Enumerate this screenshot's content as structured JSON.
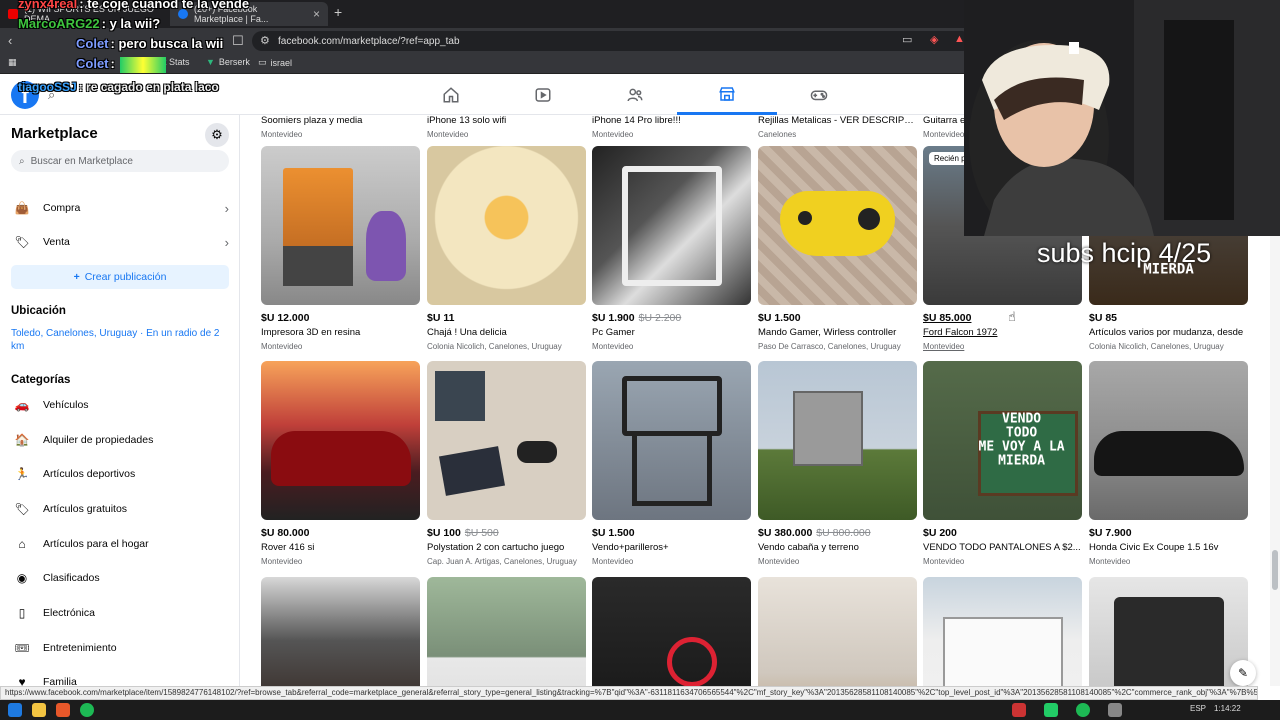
{
  "browser": {
    "tabs": [
      {
        "label": "(1) WII SPORTS ES UN JUEGO DEMA..."
      },
      {
        "label": "(20+) Facebook Marketplace | Fa..."
      }
    ],
    "url": "facebook.com/marketplace/?ref=app_tab",
    "bookmarks": [
      {
        "label": "...ck Stats"
      },
      {
        "label": "Berserk"
      },
      {
        "label": "israel"
      }
    ]
  },
  "chat": [
    {
      "nick": "zynx4real",
      "text": "te coje cuanod te la vende",
      "color": "#ff4545"
    },
    {
      "nick": "MarcoARG22",
      "text": "y la wii?",
      "color": "#3ec43e"
    },
    {
      "nick": "Colet",
      "text": "pero busca la wii",
      "color": "#7d9bff"
    },
    {
      "nick": "Colet",
      "text": "",
      "color": "#7d9bff"
    },
    {
      "nick": "tiagooSSJ",
      "text": "re cagado en plata laco",
      "color": "#3aa3ff"
    }
  ],
  "sidebar": {
    "title": "Marketplace",
    "search_placeholder": "Buscar en Marketplace",
    "items": [
      {
        "label": "Compra",
        "icon": "bag-icon"
      },
      {
        "label": "Venta",
        "icon": "tag-icon"
      }
    ],
    "create_label": "Crear publicación",
    "location_heading": "Ubicación",
    "location_text": "Toledo, Canelones, Uruguay · En un radio de 2 km",
    "categories_heading": "Categorías",
    "categories": [
      {
        "label": "Vehículos",
        "icon": "car-icon"
      },
      {
        "label": "Alquiler de propiedades",
        "icon": "house-icon"
      },
      {
        "label": "Artículos deportivos",
        "icon": "runner-icon"
      },
      {
        "label": "Artículos gratuitos",
        "icon": "free-tag-icon"
      },
      {
        "label": "Artículos para el hogar",
        "icon": "home-icon"
      },
      {
        "label": "Clasificados",
        "icon": "classified-icon"
      },
      {
        "label": "Electrónica",
        "icon": "phone-icon"
      },
      {
        "label": "Entretenimiento",
        "icon": "ticket-icon"
      },
      {
        "label": "Familia",
        "icon": "heart-icon"
      }
    ]
  },
  "top_row": [
    {
      "title": "Soomiers plaza y media",
      "loc": "Montevideo"
    },
    {
      "title": "iPhone 13 solo wifi",
      "loc": "Montevideo"
    },
    {
      "title": "iPhone 14 Pro libre!!!",
      "loc": "Montevideo"
    },
    {
      "title": "Rejillas Metalicas - VER DESCRIPCI...",
      "loc": "Canelones"
    },
    {
      "title": "Guitarra e",
      "loc": "Montevideo"
    }
  ],
  "listings": [
    {
      "price": "$U 12.000",
      "old": "",
      "title": "Impresora 3D en resina",
      "loc": "Montevideo"
    },
    {
      "price": "$U 11",
      "old": "",
      "title": "Chajá ! Una delicia",
      "loc": "Colonia Nicolich, Canelones, Uruguay"
    },
    {
      "price": "$U 1.900",
      "old": "$U 2.200",
      "title": "Pc Gamer",
      "loc": "Montevideo"
    },
    {
      "price": "$U 1.500",
      "old": "",
      "title": "Mando Gamer, Wirless controller",
      "loc": "Paso De Carrasco, Canelones, Uruguay"
    },
    {
      "price": "$U 85.000",
      "old": "",
      "title": "Ford Falcon 1972",
      "loc": "Montevideo",
      "badge": "Recién p"
    },
    {
      "price": "$U 85",
      "old": "",
      "title": "Artículos varios por mudanza, desde",
      "loc": "Colonia Nicolich, Canelones, Uruguay"
    },
    {
      "price": "$U 80.000",
      "old": "",
      "title": "Rover 416 si",
      "loc": "Montevideo"
    },
    {
      "price": "$U 100",
      "old": "$U 500",
      "title": "Polystation 2 con cartucho juego",
      "loc": "Cap. Juan A. Artigas, Canelones, Uruguay"
    },
    {
      "price": "$U 1.500",
      "old": "",
      "title": "Vendo+parilleros+",
      "loc": "Montevideo"
    },
    {
      "price": "$U 380.000",
      "old": "$U 800.000",
      "title": "Vendo cabaña y terreno",
      "loc": "Montevideo"
    },
    {
      "price": "$U 200",
      "old": "",
      "title": "VENDO TODO PANTALONES A $2...",
      "loc": "Montevideo"
    },
    {
      "price": "$U 7.900",
      "old": "",
      "title": "Honda Civic Ex Coupe 1.5 16v",
      "loc": "Montevideo"
    }
  ],
  "sign1": "VENDO\nTODO\nME VOY A LA\nMIERDA",
  "sign2": "MIERDA",
  "overlay_text": "subs hcip 4/25",
  "status_url": "https://www.facebook.com/marketplace/item/1589824776148102/?ref=browse_tab&referral_code=marketplace_general&referral_story_type=general_listing&tracking=%7B\"qid\"%3A\"-6311811634706565544\"%2C\"mf_story_key\"%3A\"20135628581108140085\"%2C\"top_level_post_id\"%3A\"20135628581108140085\"%2C\"commerce_rank_obj\"%3A\"%7B%5C\"ta...",
  "taskbar": {
    "lang": "ESP",
    "time": "1:14:22"
  }
}
